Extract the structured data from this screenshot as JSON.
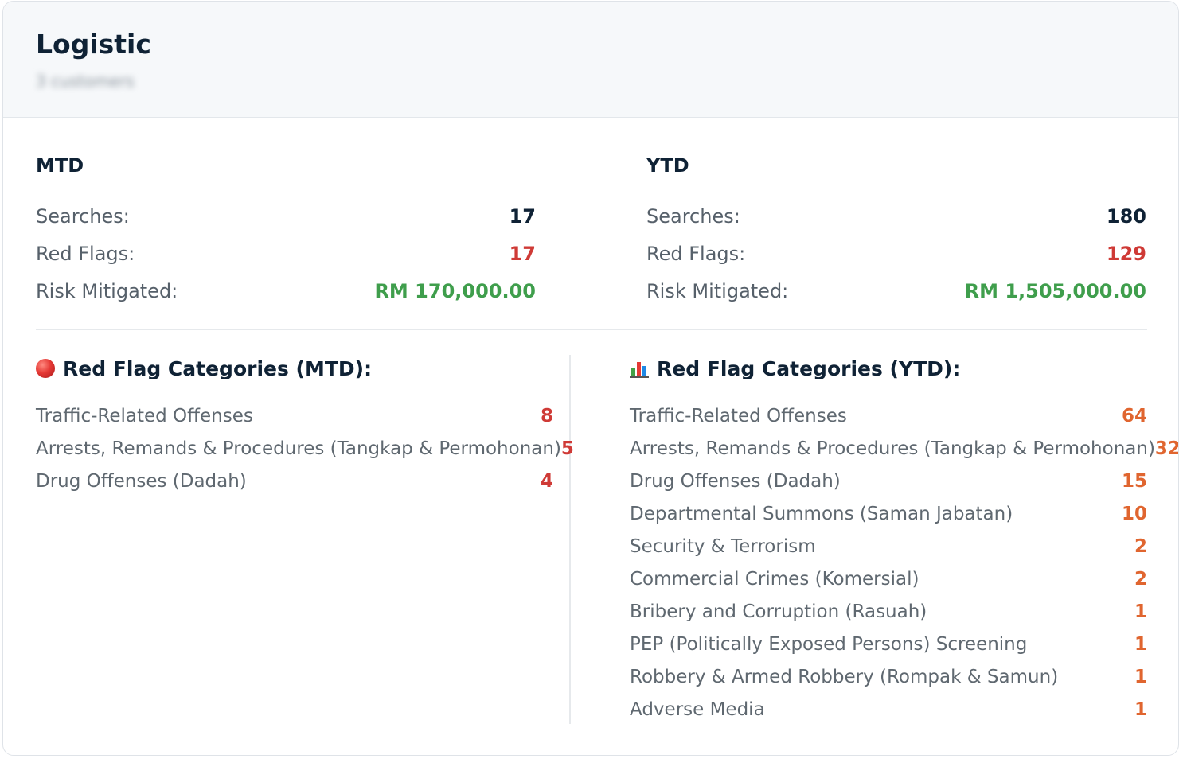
{
  "card": {
    "title": "Logistic",
    "subtitle": "3 customers"
  },
  "mtd": {
    "title": "MTD",
    "searches_label": "Searches:",
    "searches": "17",
    "red_flags_label": "Red Flags:",
    "red_flags": "17",
    "risk_label": "Risk Mitigated:",
    "risk": "RM 170,000.00"
  },
  "ytd": {
    "title": "YTD",
    "searches_label": "Searches:",
    "searches": "180",
    "red_flags_label": "Red Flags:",
    "red_flags": "129",
    "risk_label": "Risk Mitigated:",
    "risk": "RM 1,505,000.00"
  },
  "categories_mtd": {
    "icon": "red-circle-icon",
    "heading": "Red Flag Categories (MTD):",
    "count_color": "#cf3a36",
    "items": [
      {
        "label": "Traffic-Related Offenses",
        "count": "8"
      },
      {
        "label": "Arrests, Remands & Procedures (Tangkap & Permohonan)",
        "count": "5"
      },
      {
        "label": "Drug Offenses (Dadah)",
        "count": "4"
      }
    ]
  },
  "categories_ytd": {
    "icon": "bar-chart-icon",
    "heading": "Red Flag Categories (YTD):",
    "count_color": "#e0652f",
    "items": [
      {
        "label": "Traffic-Related Offenses",
        "count": "64"
      },
      {
        "label": "Arrests, Remands & Procedures (Tangkap & Permohonan)",
        "count": "32"
      },
      {
        "label": "Drug Offenses (Dadah)",
        "count": "15"
      },
      {
        "label": "Departmental Summons (Saman Jabatan)",
        "count": "10"
      },
      {
        "label": "Security & Terrorism",
        "count": "2"
      },
      {
        "label": "Commercial Crimes (Komersial)",
        "count": "2"
      },
      {
        "label": "Bribery and Corruption (Rasuah)",
        "count": "1"
      },
      {
        "label": "PEP (Politically Exposed Persons) Screening",
        "count": "1"
      },
      {
        "label": "Robbery & Armed Robbery (Rompak & Samun)",
        "count": "1"
      },
      {
        "label": "Adverse Media",
        "count": "1"
      }
    ]
  },
  "colors": {
    "title": "#0f2235",
    "red": "#cf3a36",
    "green": "#3f9e4c",
    "orange": "#e0652f"
  }
}
